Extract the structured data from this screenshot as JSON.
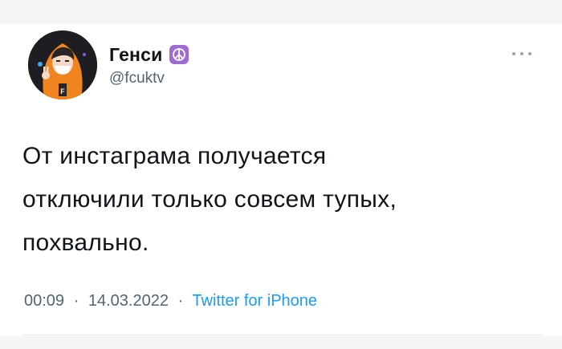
{
  "tweet": {
    "author": {
      "display_name": "Генси",
      "handle": "@fcuktv",
      "badge_icon": "peace-sign-icon",
      "badge_color": "#a06bd0"
    },
    "text_lines": [
      "От инстаграма получается",
      "отключили только совсем тупых,",
      "похвально."
    ],
    "meta": {
      "time": "00:09",
      "separator": "·",
      "date": "14.03.2022",
      "source": "Twitter for iPhone"
    },
    "more_icon": "more-horizontal-icon"
  },
  "colors": {
    "text": "#0f1419",
    "secondary": "#536471",
    "link": "#1d9bf0",
    "avatar_hoodie": "#f0841e"
  }
}
